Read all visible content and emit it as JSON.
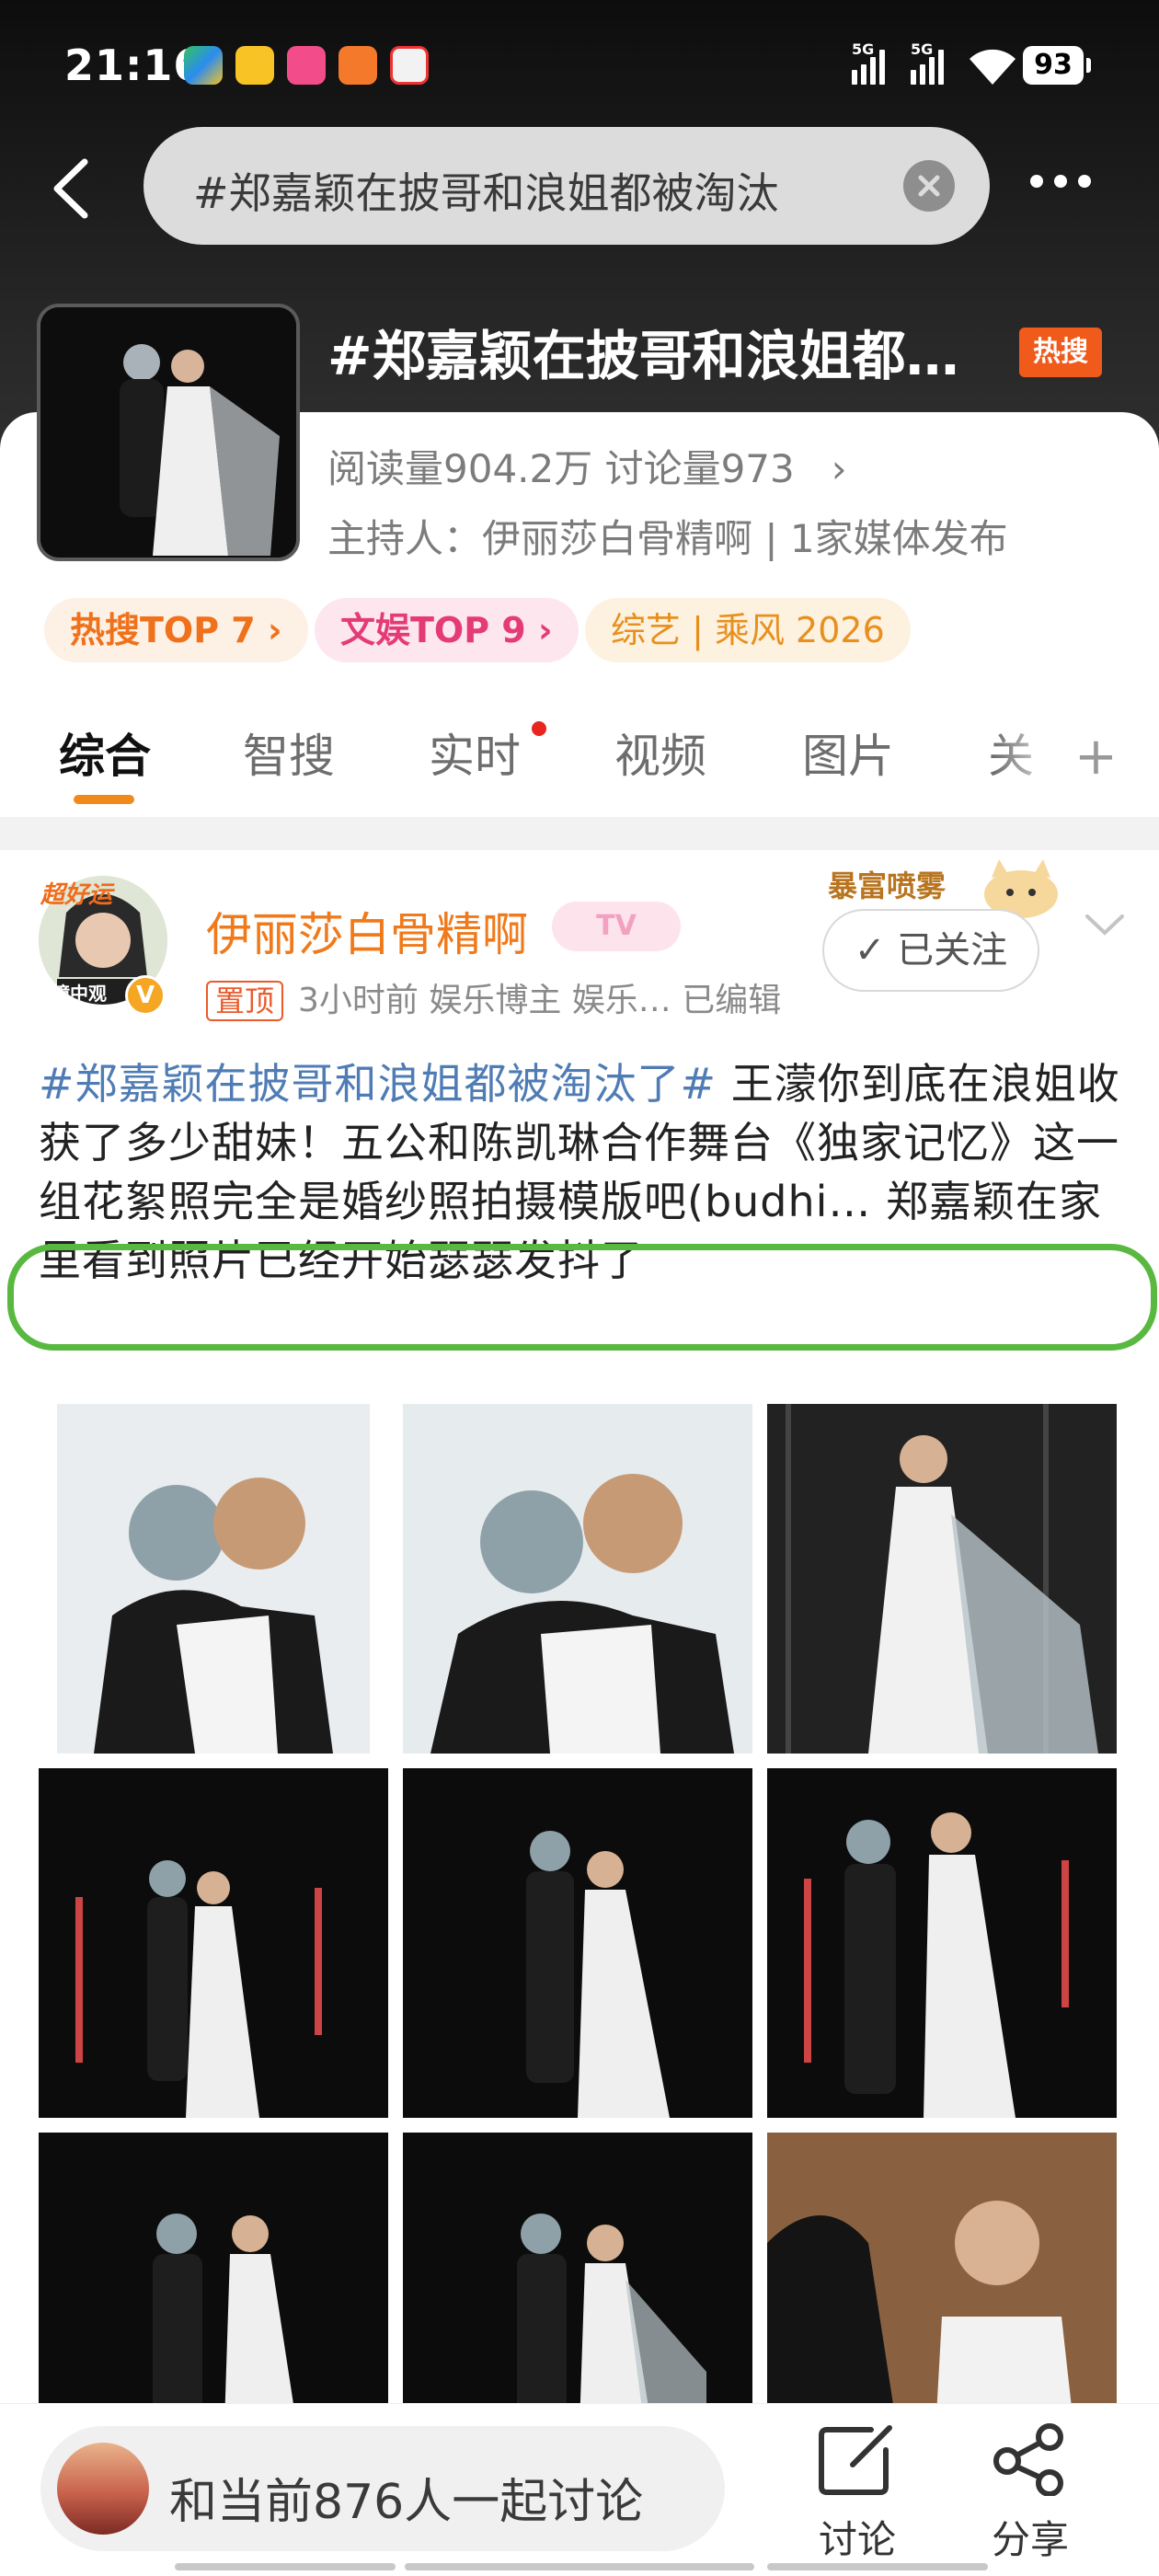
{
  "status_bar": {
    "time": "21:16",
    "network1": "5G",
    "network2": "5G",
    "battery": "93"
  },
  "search": {
    "query": "#郑嘉颖在披哥和浪姐都被淘汰"
  },
  "topic": {
    "title": "#郑嘉颖在披哥和浪姐都…",
    "hot_label": "热搜",
    "stats": "阅读量904.2万  讨论量973",
    "host": "主持人：伊丽莎白骨精啊 | 1家媒体发布",
    "chips": [
      "热搜TOP 7 ›",
      "文娱TOP 9 ›",
      "综艺 | 乘风 2026"
    ]
  },
  "tabs": [
    "综合",
    "智搜",
    "实时",
    "视频",
    "图片",
    "关"
  ],
  "post": {
    "avatar_badge": "超好运",
    "avatar_caption": "瞳中观",
    "v_badge": "V",
    "author": "伊丽莎白骨精啊",
    "tv_badge": "TV",
    "pinned_label": "置顶",
    "meta": "3小时前  娱乐博主 娱乐…  已编辑",
    "follow_label": "✓ 已关注",
    "sticker_text": "暴富喷雾",
    "hashtag": "#郑嘉颖在披哥和浪姐都被淘汰了#",
    "body": " 王濛你到底在浪姐收获了多少甜妹！五公和陈凯琳合作舞台《独家记忆》这一组花絮照完全是婚纱照拍摄模版吧(budhi… 郑嘉颖在家里看到照片已经开始瑟瑟发抖了"
  },
  "bottom_bar": {
    "discuss_prompt": "和当前876人一起讨论",
    "discuss_label": "讨论",
    "share_label": "分享"
  },
  "colors": {
    "accent_orange": "#f07a1b",
    "hashtag_blue": "#4f7cb5",
    "highlight_green": "#59b83f",
    "hot_red": "#f05a1b"
  }
}
